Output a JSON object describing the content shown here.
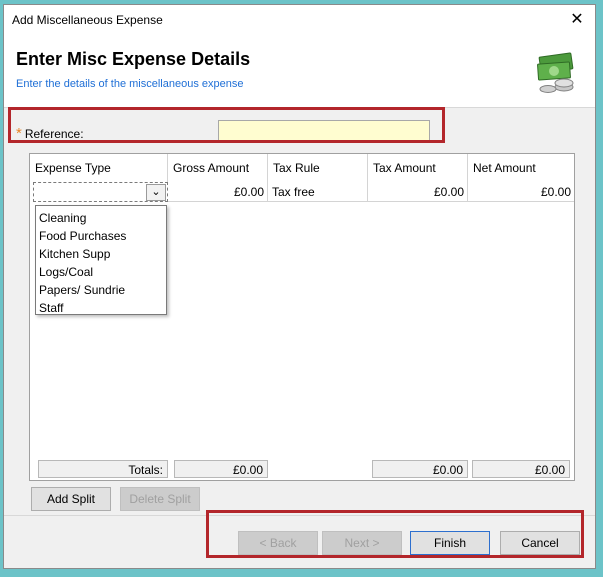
{
  "window": {
    "title": "Add Miscellaneous Expense",
    "close_glyph": "✕"
  },
  "header": {
    "title": "Enter Misc Expense Details",
    "subtitle": "Enter the details of the miscellaneous expense",
    "icon": "money-icon"
  },
  "reference": {
    "required_marker": "*",
    "label": "Reference:",
    "value": ""
  },
  "grid": {
    "columns": [
      "Expense Type",
      "Gross Amount",
      "Tax Rule",
      "Tax Amount",
      "Net Amount"
    ],
    "row": {
      "expense_type": "",
      "gross": "£0.00",
      "tax_rule": "Tax free",
      "tax": "£0.00",
      "net": "£0.00"
    },
    "dropdown_options": [
      "Cleaning",
      "Food Purchases",
      "Kitchen Supp",
      "Logs/Coal",
      "Papers/ Sundrie",
      "Staff"
    ],
    "totals": {
      "label": "Totals:",
      "gross": "£0.00",
      "tax": "£0.00",
      "net": "£0.00"
    }
  },
  "buttons": {
    "add_split": "Add Split",
    "delete_split": "Delete Split",
    "back": "< Back",
    "next": "Next >",
    "finish": "Finish",
    "cancel": "Cancel"
  },
  "colors": {
    "highlight": "#b3262b",
    "background": "#6cc3c8",
    "reference_field": "#fffdd0",
    "subtitle": "#1f6fd6"
  }
}
